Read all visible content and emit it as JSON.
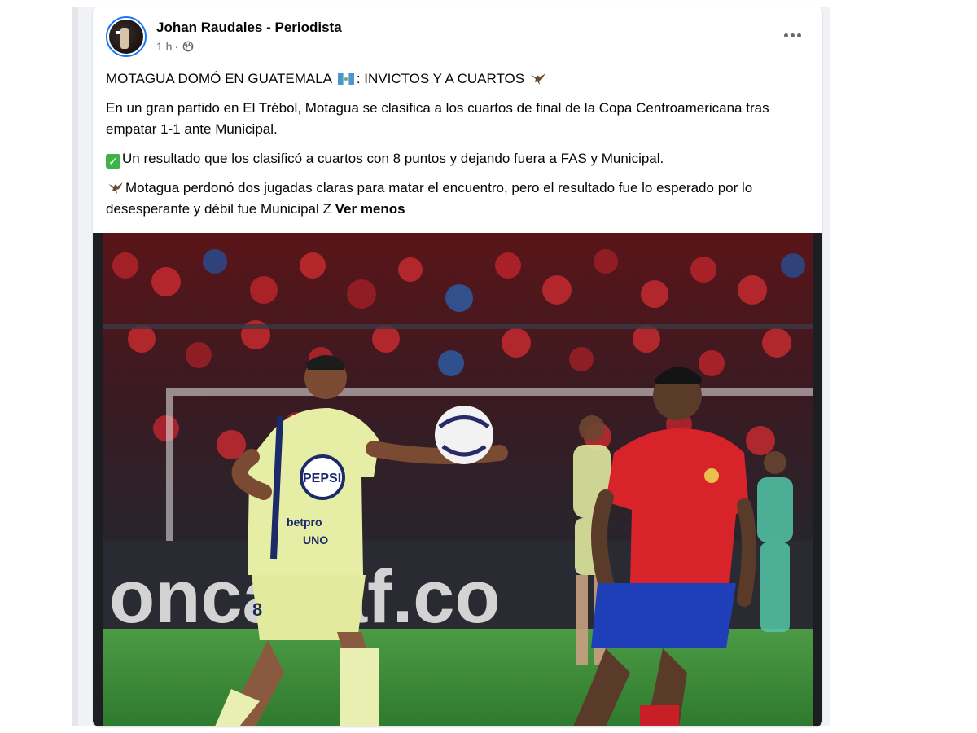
{
  "post": {
    "author": "Johan Raudales - Periodista",
    "time": "1 h",
    "separator": "·",
    "privacy_icon": "globe-icon",
    "more_icon": "more-options-icon",
    "headline_part1": "MOTAGUA DOMÓ EN GUATEMALA",
    "headline_part2": ": INVICTOS Y A CUARTOS",
    "paragraph1": "En un gran partido en El Trébol, Motagua se clasifica a los cuartos de final de la Copa Centroamericana tras empatar 1-1 ante Municipal.",
    "check_icon_glyph": "✓",
    "paragraph2": "Un resultado que los clasificó a cuartos con 8 puntos y dejando fuera a FAS y Municipal.",
    "paragraph3": "Motagua perdonó dos jugadas claras para matar el encuentro, pero el resultado fue lo esperado por lo desesperante y débil fue Municipal Z",
    "see_less": "Ver menos"
  },
  "photo": {
    "board_text": "oncacaf.co",
    "player1_number": "8",
    "sponsor_text": "PEPSI",
    "sponsor2_text": "betpro",
    "sponsor3_text": "UNO"
  },
  "colors": {
    "accent": "#1877f2",
    "text": "#050505",
    "secondary_text": "#65676b",
    "motagua_kit": "#e8efb0",
    "municipal_kit": "#d8232a",
    "pitch": "#3f8a3a"
  }
}
